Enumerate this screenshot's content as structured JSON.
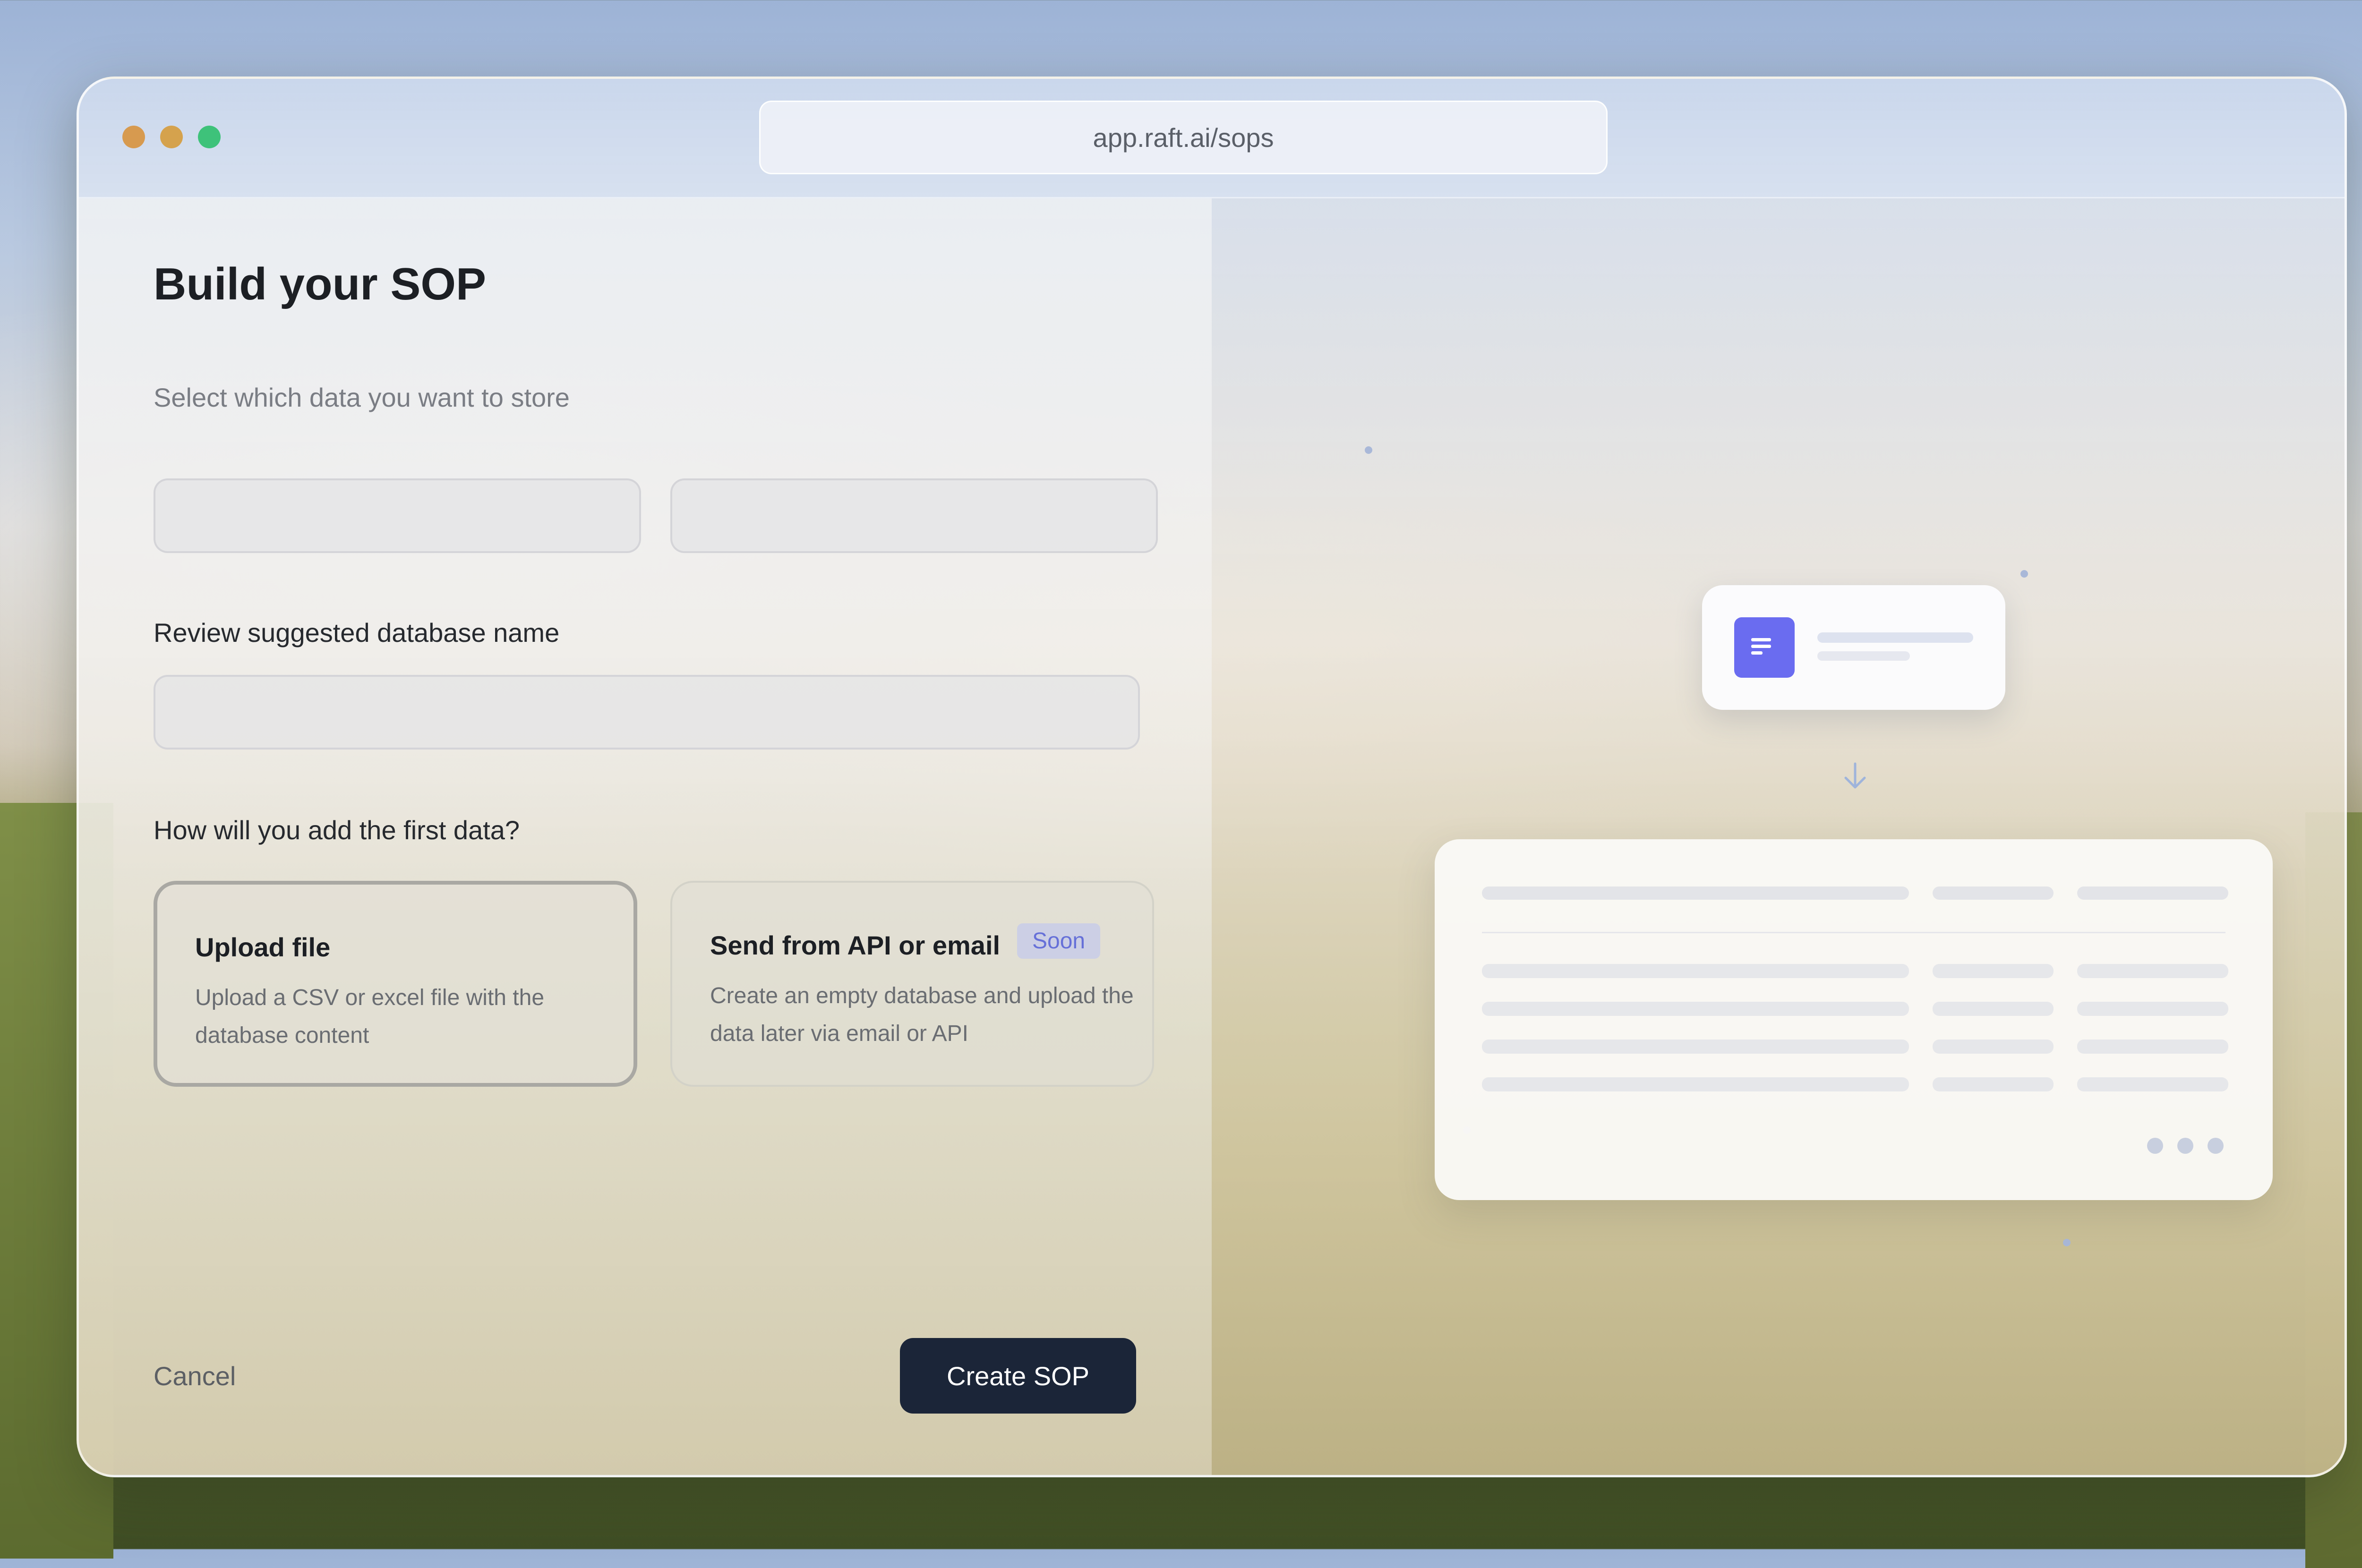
{
  "window": {
    "url": "app.raft.ai/sops"
  },
  "form": {
    "title": "Build your SOP",
    "subtitle": "Select which data you want to store",
    "db_name_label": "Review suggested database name",
    "add_data_label": "How will you add the first data?",
    "options": [
      {
        "title": "Upload file",
        "description": "Upload a CSV or excel file with the database content",
        "selected": true
      },
      {
        "title": "Send from API or email",
        "badge": "Soon",
        "description": "Create an empty database and upload the data later via email or API",
        "selected": false
      }
    ],
    "cancel_label": "Cancel",
    "submit_label": "Create SOP"
  },
  "colors": {
    "primary_button": "#1b2538",
    "accent": "#6a6cf0",
    "badge_text": "#6670d8",
    "traffic_close": "#d79a4f",
    "traffic_minimize": "#d5a24d",
    "traffic_maximize": "#3ec27a"
  },
  "icons": {
    "document": "document-icon",
    "arrow": "arrow-down-icon"
  }
}
